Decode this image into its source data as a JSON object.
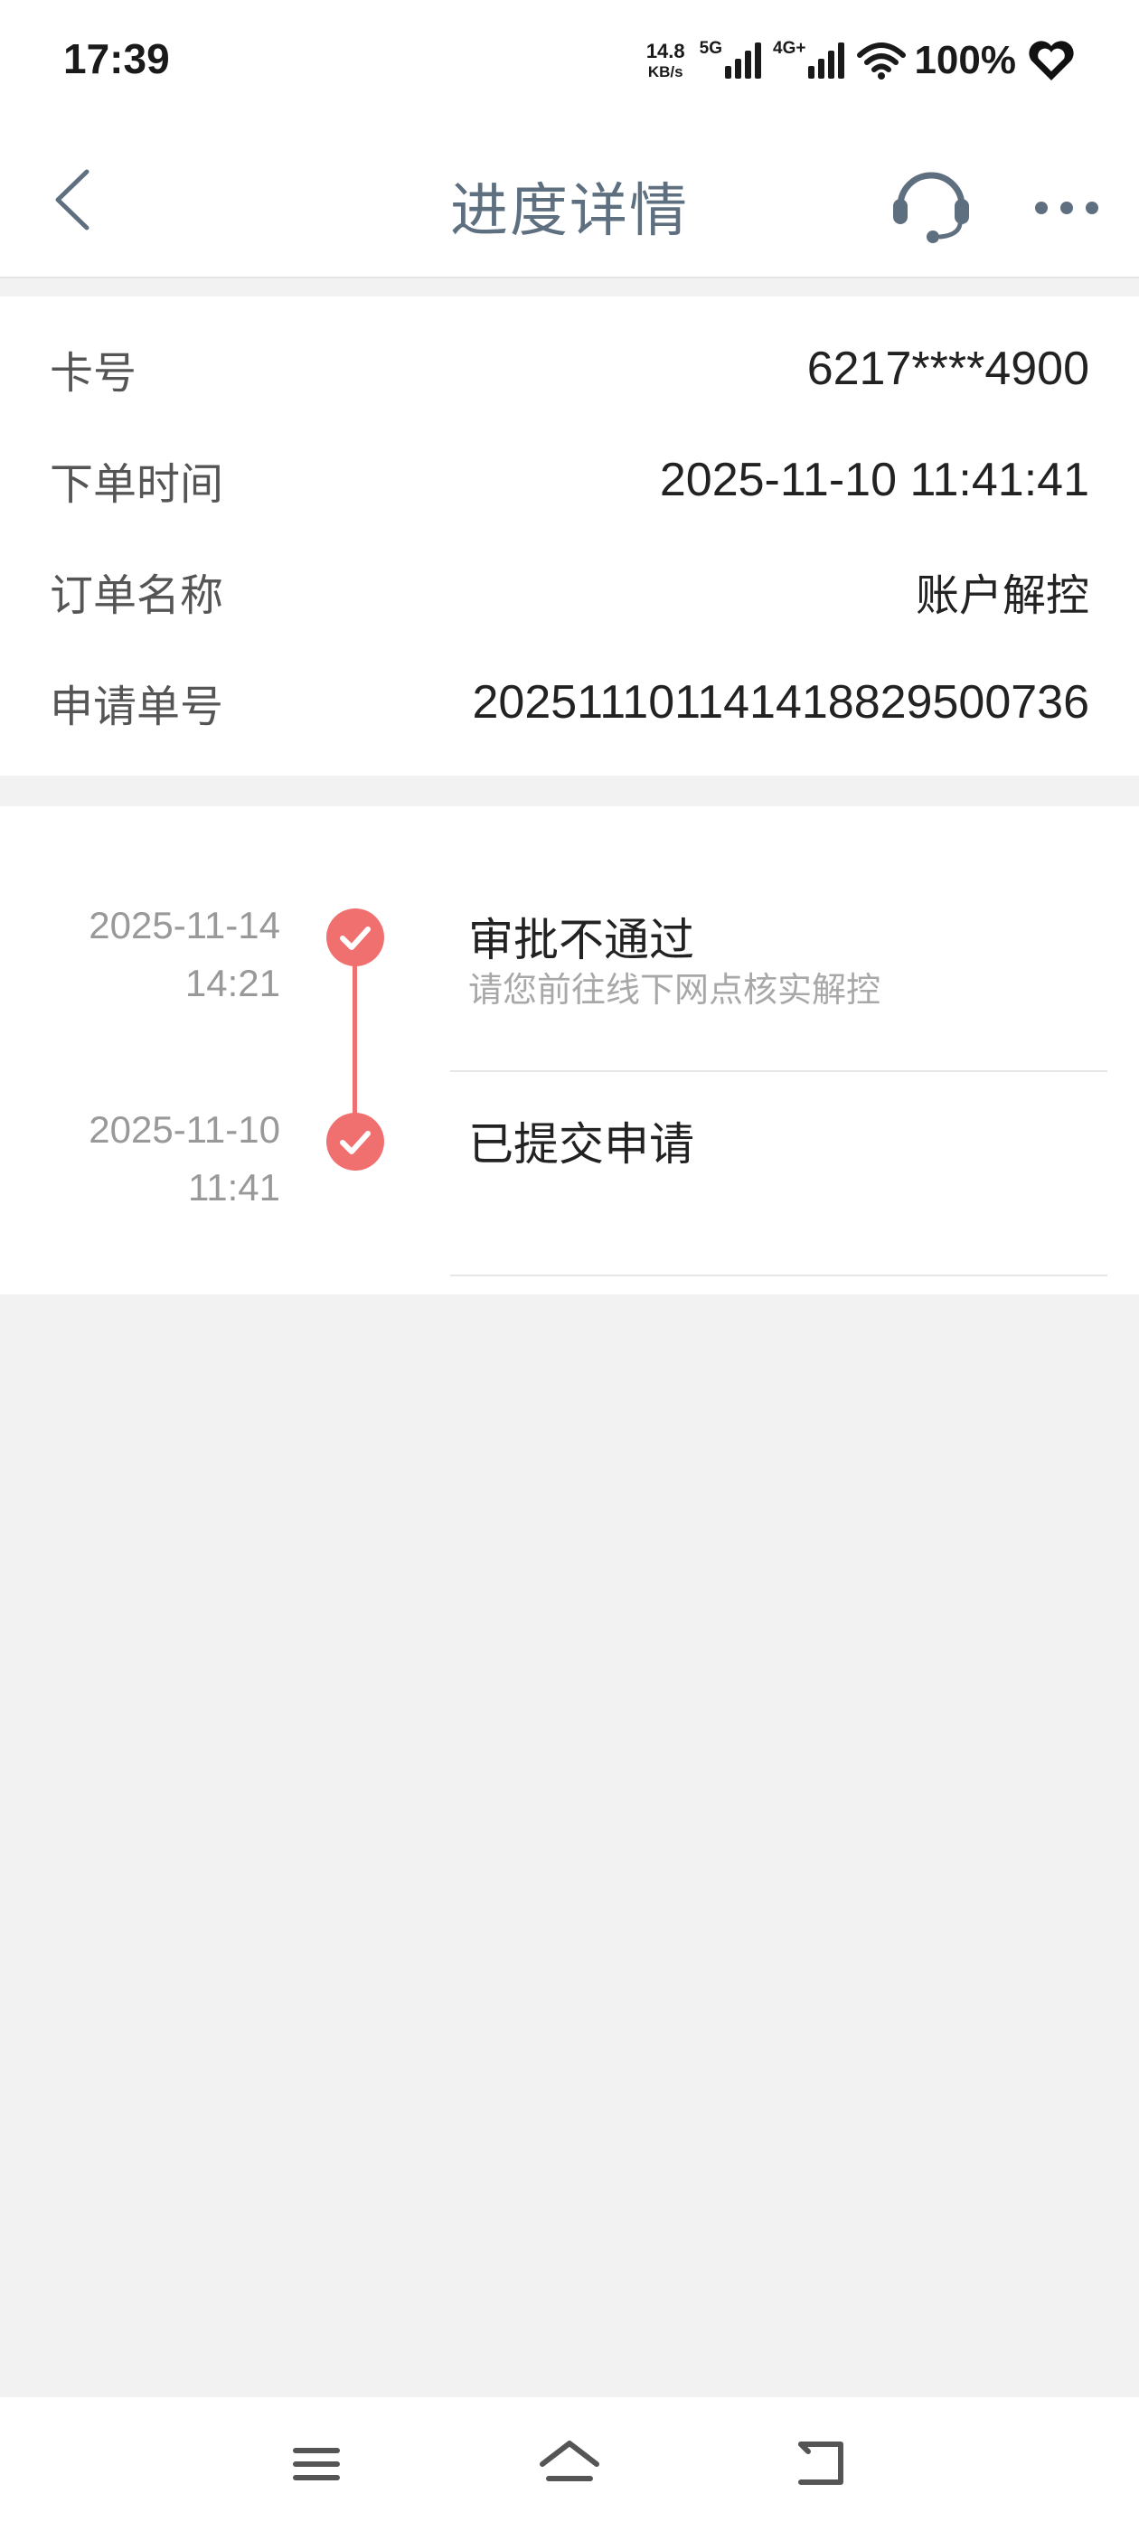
{
  "status_bar": {
    "time": "17:39",
    "net_speed_value": "14.8",
    "net_speed_unit": "KB/s",
    "signal_1_label": "5G",
    "signal_2_label": "4G+",
    "battery": "100%",
    "icons": [
      "signal-icon",
      "wifi-icon",
      "heart-icon"
    ]
  },
  "nav": {
    "title": "进度详情",
    "icons": [
      "back-icon",
      "customer-service-icon",
      "more-icon"
    ]
  },
  "info": {
    "rows": [
      {
        "label": "卡号",
        "value": "6217****4900"
      },
      {
        "label": "下单时间",
        "value": "2025-11-10 11:41:41"
      },
      {
        "label": "订单名称",
        "value": "账户解控"
      },
      {
        "label": "申请单号",
        "value": "20251110114141882950 0736"
      }
    ]
  },
  "timeline": {
    "accent_color": "#f07070",
    "items": [
      {
        "date": "2025-11-14",
        "time": "14:21",
        "title": "审批不通过",
        "subtitle": "请您前往线下网点核实解控"
      },
      {
        "date": "2025-11-10",
        "time": "11:41",
        "title": "已提交申请",
        "subtitle": ""
      }
    ]
  },
  "system_nav": {
    "icons": [
      "menu-icon",
      "home-icon",
      "back-nav-icon"
    ]
  }
}
